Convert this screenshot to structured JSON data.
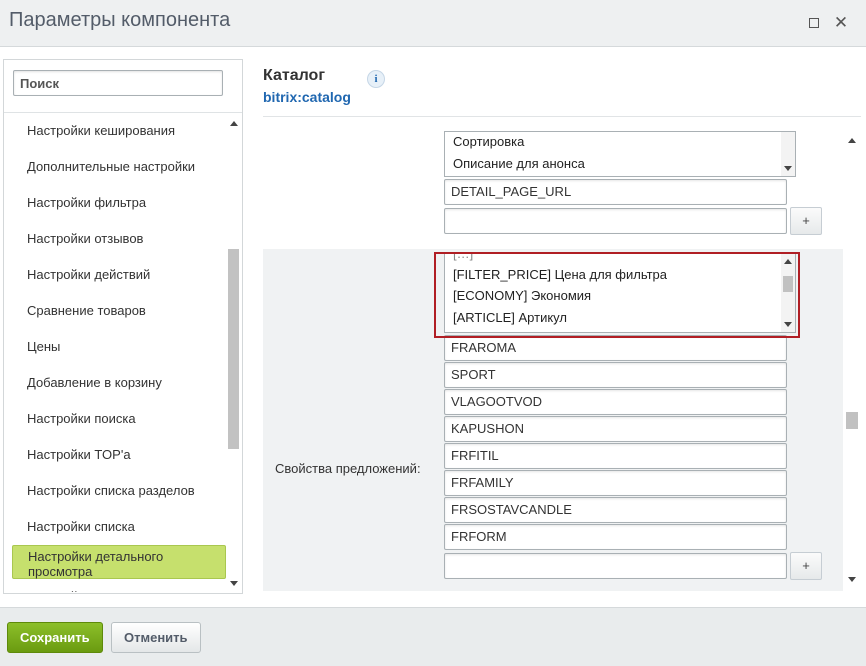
{
  "dialog": {
    "title": "Параметры компонента"
  },
  "sidebar": {
    "search_placeholder": "Поиск",
    "items": [
      "Настройки кеширования",
      "Дополнительные настройки",
      "Настройки фильтра",
      "Настройки отзывов",
      "Настройки действий",
      "Сравнение товаров",
      "Цены",
      "Добавление в корзину",
      "Настройки поиска",
      "Настройки TOP'а",
      "Настройки списка разделов",
      "Настройки списка",
      "Настройки детального просмотра",
      "Настройки"
    ],
    "active_item": "Настройки детального просмотра"
  },
  "header": {
    "title": "Каталог",
    "code": "bitrix:catalog",
    "info_icon": "i"
  },
  "properties": {
    "top_list_options": [
      "Сортировка",
      "Описание для анонса"
    ],
    "top_inputs": [
      "DETAIL_PAGE_URL",
      ""
    ],
    "plus_label": "+",
    "offer_label": "Свойства предложений:",
    "offer_list_options": [
      "[FILTER_PRICE] Цена для фильтра",
      "[ECONOMY] Экономия",
      "[ARTICLE] Артикул"
    ],
    "offer_inputs": [
      "FRAROMA",
      "SPORT",
      "VLAGOOTVOD",
      "KAPUSHON",
      "FRFITIL",
      "FRFAMILY",
      "FRSOSTAVCANDLE",
      "FRFORM",
      ""
    ]
  },
  "footer": {
    "save_label": "Сохранить",
    "cancel_label": "Отменить"
  },
  "colors": {
    "save_button": "#78a814",
    "active_item": "#c6e06d",
    "highlight_border": "#b01e24",
    "link": "#2067b0"
  }
}
